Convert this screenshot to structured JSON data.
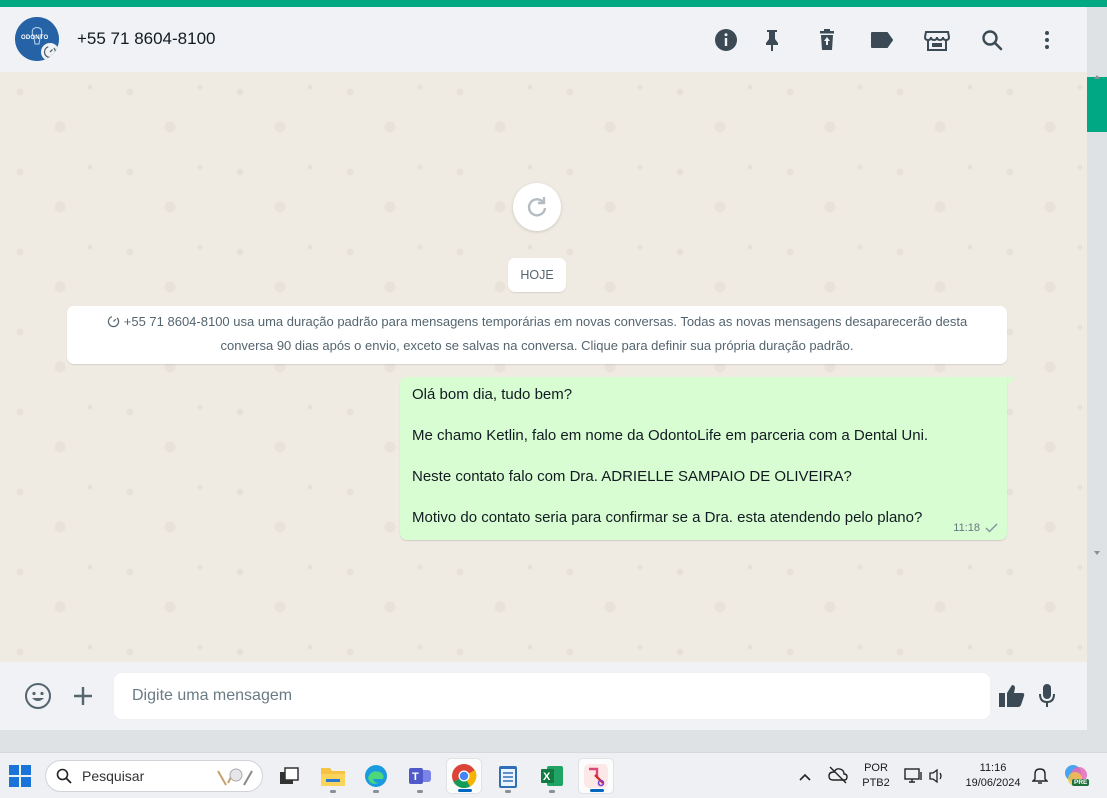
{
  "header": {
    "contact_name": "+55 71 8604-8100",
    "avatar_logo_text": "ODONTO",
    "icons": [
      "info-icon",
      "pin-icon",
      "delete-icon",
      "label-icon",
      "store-icon",
      "search-icon",
      "more-icon"
    ]
  },
  "chat": {
    "date_label": "HOJE",
    "system_message": "+55 71 8604-8100 usa uma duração padrão para mensagens temporárias em novas conversas. Todas as novas mensagens desaparecerão desta conversa 90 dias após o envio, exceto se salvas na conversa. Clique para definir sua própria duração padrão.",
    "messages": [
      {
        "direction": "outgoing",
        "lines": [
          "Olá bom dia, tudo bem?",
          "Me chamo Ketlin, falo em nome da OdontoLife em parceria com a Dental Uni.",
          "Neste contato falo com Dra. ADRIELLE SAMPAIO DE OLIVEIRA?",
          "Motivo do contato seria para confirmar se a Dra. esta atendendo pelo plano?"
        ],
        "time": "11:18",
        "status": "sent"
      }
    ]
  },
  "composer": {
    "placeholder": "Digite uma mensagem",
    "value": ""
  },
  "taskbar": {
    "search_label": "Pesquisar",
    "language": "POR",
    "layout": "PTB2",
    "time": "11:16",
    "date": "19/06/2024",
    "copilot_badge": "PRE"
  },
  "colors": {
    "accent": "#00a884",
    "bubble_out": "#d9fdd3",
    "chat_bg": "#efeae2",
    "header_bg": "#f0f2f5"
  }
}
